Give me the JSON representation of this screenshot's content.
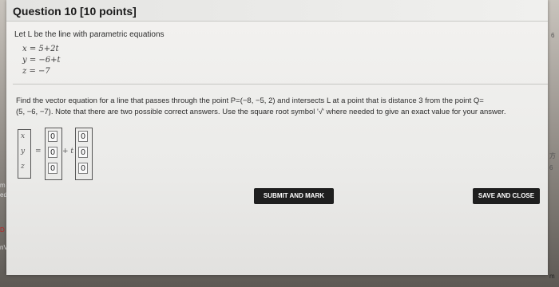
{
  "question": {
    "title": "Question 10 [10 points]",
    "intro": "Let L be the line with parametric equations",
    "equations": [
      "x = 5+2t",
      "y = −6+t",
      "z = −7"
    ],
    "prompt_line1": "Find the vector equation for a line that passes through the point P=(−8, −5, 2) and intersects L at a point that is distance 3 from the point Q=",
    "prompt_line2": "(5, −6, −7). Note that there are two possible correct answers. Use the square root symbol '√' where needed to give an exact value for your answer."
  },
  "answer": {
    "vars": [
      "x",
      "y",
      "z"
    ],
    "equals": "=",
    "plus_t": "+ t",
    "point_values": [
      "0",
      "0",
      "0"
    ],
    "direction_values": [
      "0",
      "0",
      "0"
    ]
  },
  "buttons": {
    "submit": "SUBMIT AND MARK",
    "save": "SAVE AND CLOSE"
  },
  "edge_text": {
    "right_top": "6",
    "right_mid1": "方",
    "right_mid2": "6",
    "right_bottom": "m",
    "left_1": "m",
    "left_2": "ed",
    "left_3": "D",
    "left_4": "nV"
  }
}
